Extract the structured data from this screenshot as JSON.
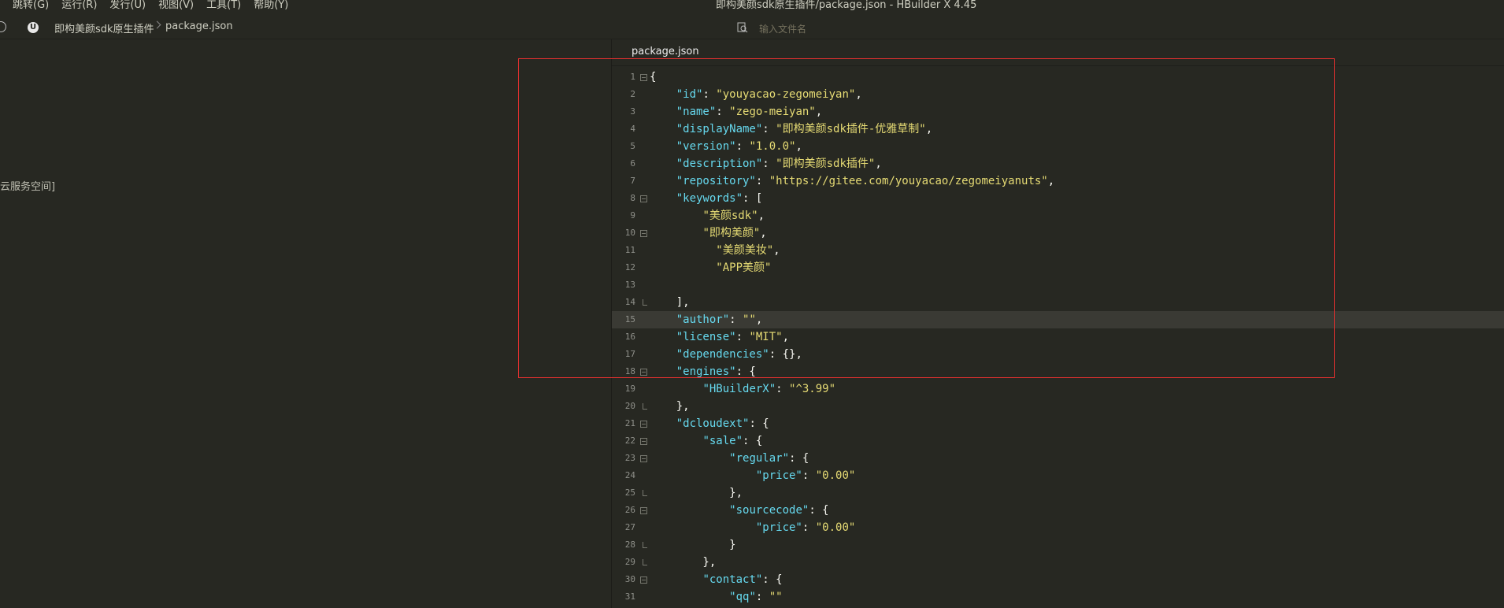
{
  "menu": {
    "items": [
      "跳转(G)",
      "运行(R)",
      "发行(U)",
      "视图(V)",
      "工具(T)",
      "帮助(Y)"
    ]
  },
  "window": {
    "title": "即构美颜sdk原生插件/package.json - HBuilder X 4.45"
  },
  "breadcrumb": {
    "project": "即构美颜sdk原生插件",
    "file": "package.json"
  },
  "search": {
    "placeholder": "输入文件名"
  },
  "sidebar": {
    "partial_text": "云服务空间]"
  },
  "editor": {
    "tab": "package.json",
    "current_line": 15,
    "lines": [
      {
        "n": "1",
        "fold": "open",
        "parts": [
          [
            "p",
            "{"
          ]
        ]
      },
      {
        "n": "2",
        "parts": [
          [
            "p",
            "    "
          ],
          [
            "k",
            "\"id\""
          ],
          [
            "p",
            ": "
          ],
          [
            "s",
            "\"youyacao-zegomeiyan\""
          ],
          [
            "p",
            ","
          ]
        ]
      },
      {
        "n": "3",
        "parts": [
          [
            "p",
            "    "
          ],
          [
            "k",
            "\"name\""
          ],
          [
            "p",
            ": "
          ],
          [
            "s",
            "\"zego-meiyan\""
          ],
          [
            "p",
            ","
          ]
        ]
      },
      {
        "n": "4",
        "parts": [
          [
            "p",
            "    "
          ],
          [
            "k",
            "\"displayName\""
          ],
          [
            "p",
            ": "
          ],
          [
            "s",
            "\"即构美颜sdk插件-优雅草制\""
          ],
          [
            "p",
            ","
          ]
        ]
      },
      {
        "n": "5",
        "parts": [
          [
            "p",
            "    "
          ],
          [
            "k",
            "\"version\""
          ],
          [
            "p",
            ": "
          ],
          [
            "s",
            "\"1.0.0\""
          ],
          [
            "p",
            ","
          ]
        ]
      },
      {
        "n": "6",
        "parts": [
          [
            "p",
            "    "
          ],
          [
            "k",
            "\"description\""
          ],
          [
            "p",
            ": "
          ],
          [
            "s",
            "\"即构美颜sdk插件\""
          ],
          [
            "p",
            ","
          ]
        ]
      },
      {
        "n": "7",
        "parts": [
          [
            "p",
            "    "
          ],
          [
            "k",
            "\"repository\""
          ],
          [
            "p",
            ": "
          ],
          [
            "s",
            "\"https://gitee.com/youyacao/zegomeiyanuts\""
          ],
          [
            "p",
            ","
          ]
        ]
      },
      {
        "n": "8",
        "fold": "open",
        "parts": [
          [
            "p",
            "    "
          ],
          [
            "k",
            "\"keywords\""
          ],
          [
            "p",
            ": ["
          ]
        ]
      },
      {
        "n": "9",
        "parts": [
          [
            "p",
            "        "
          ],
          [
            "s",
            "\"美颜sdk\""
          ],
          [
            "p",
            ","
          ]
        ]
      },
      {
        "n": "10",
        "fold": "open",
        "parts": [
          [
            "p",
            "        "
          ],
          [
            "s",
            "\"即构美颜\""
          ],
          [
            "p",
            ","
          ]
        ]
      },
      {
        "n": "11",
        "parts": [
          [
            "p",
            "          "
          ],
          [
            "s",
            "\"美颜美妆\""
          ],
          [
            "p",
            ","
          ]
        ]
      },
      {
        "n": "12",
        "parts": [
          [
            "p",
            "          "
          ],
          [
            "s",
            "\"APP美颜\""
          ]
        ]
      },
      {
        "n": "13",
        "parts": []
      },
      {
        "n": "14",
        "fold": "end",
        "parts": [
          [
            "p",
            "    ],"
          ]
        ]
      },
      {
        "n": "15",
        "parts": [
          [
            "p",
            "    "
          ],
          [
            "k",
            "\"author\""
          ],
          [
            "p",
            ": "
          ],
          [
            "s",
            "\"\""
          ],
          [
            "p",
            ","
          ]
        ]
      },
      {
        "n": "16",
        "parts": [
          [
            "p",
            "    "
          ],
          [
            "k",
            "\"license\""
          ],
          [
            "p",
            ": "
          ],
          [
            "s",
            "\"MIT\""
          ],
          [
            "p",
            ","
          ]
        ]
      },
      {
        "n": "17",
        "parts": [
          [
            "p",
            "    "
          ],
          [
            "k",
            "\"dependencies\""
          ],
          [
            "p",
            ": {},"
          ]
        ]
      },
      {
        "n": "18",
        "fold": "open",
        "parts": [
          [
            "p",
            "    "
          ],
          [
            "k",
            "\"engines\""
          ],
          [
            "p",
            ": {"
          ]
        ]
      },
      {
        "n": "19",
        "parts": [
          [
            "p",
            "        "
          ],
          [
            "k",
            "\"HBuilderX\""
          ],
          [
            "p",
            ": "
          ],
          [
            "s",
            "\"^3.99\""
          ]
        ]
      },
      {
        "n": "20",
        "fold": "end",
        "parts": [
          [
            "p",
            "    },"
          ]
        ]
      },
      {
        "n": "21",
        "fold": "open",
        "parts": [
          [
            "p",
            "    "
          ],
          [
            "k",
            "\"dcloudext\""
          ],
          [
            "p",
            ": {"
          ]
        ]
      },
      {
        "n": "22",
        "fold": "open",
        "parts": [
          [
            "p",
            "        "
          ],
          [
            "k",
            "\"sale\""
          ],
          [
            "p",
            ": {"
          ]
        ]
      },
      {
        "n": "23",
        "fold": "open",
        "parts": [
          [
            "p",
            "            "
          ],
          [
            "k",
            "\"regular\""
          ],
          [
            "p",
            ": {"
          ]
        ]
      },
      {
        "n": "24",
        "parts": [
          [
            "p",
            "                "
          ],
          [
            "k",
            "\"price\""
          ],
          [
            "p",
            ": "
          ],
          [
            "s",
            "\"0.00\""
          ]
        ]
      },
      {
        "n": "25",
        "fold": "end",
        "parts": [
          [
            "p",
            "            },"
          ]
        ]
      },
      {
        "n": "26",
        "fold": "open",
        "parts": [
          [
            "p",
            "            "
          ],
          [
            "k",
            "\"sourcecode\""
          ],
          [
            "p",
            ": {"
          ]
        ]
      },
      {
        "n": "27",
        "parts": [
          [
            "p",
            "                "
          ],
          [
            "k",
            "\"price\""
          ],
          [
            "p",
            ": "
          ],
          [
            "s",
            "\"0.00\""
          ]
        ]
      },
      {
        "n": "28",
        "fold": "end",
        "parts": [
          [
            "p",
            "            }"
          ]
        ]
      },
      {
        "n": "29",
        "fold": "end",
        "parts": [
          [
            "p",
            "        },"
          ]
        ]
      },
      {
        "n": "30",
        "fold": "open",
        "parts": [
          [
            "p",
            "        "
          ],
          [
            "k",
            "\"contact\""
          ],
          [
            "p",
            ": {"
          ]
        ]
      },
      {
        "n": "31",
        "parts": [
          [
            "p",
            "            "
          ],
          [
            "k",
            "\"qq\""
          ],
          [
            "p",
            ": "
          ],
          [
            "s",
            "\"\""
          ]
        ]
      }
    ]
  },
  "colors": {
    "background": "#272822",
    "key": "#66d9ef",
    "string": "#e6db74",
    "highlight_box": "#e0302f"
  }
}
